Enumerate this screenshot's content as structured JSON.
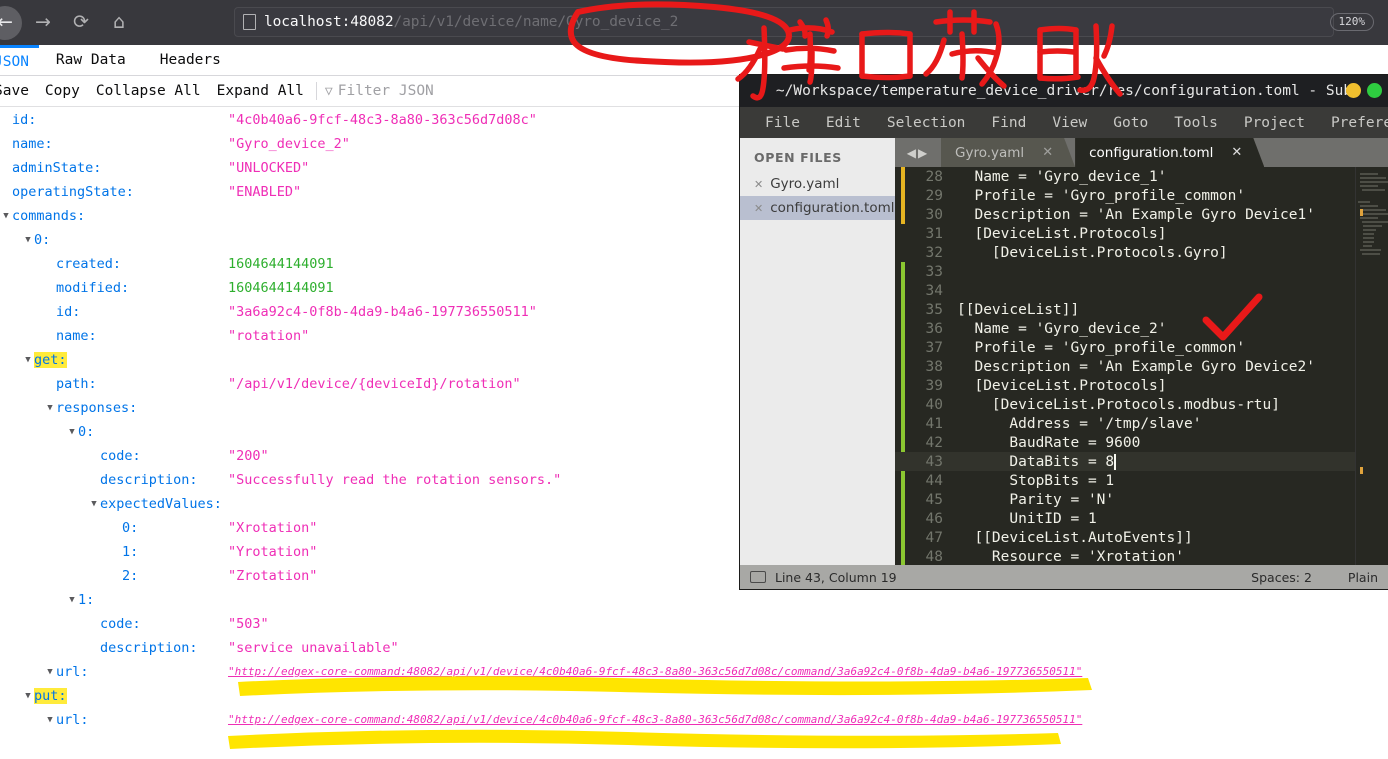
{
  "browser": {
    "nav": {
      "back_icon": "arrow-left-icon",
      "forward_icon": "arrow-right-icon",
      "reload_icon": "reload-icon",
      "home_icon": "home-icon"
    },
    "url_host": "localhost:48082",
    "url_path": "/api/v1/device/name/Gyro_device_2",
    "zoom_level": "120%"
  },
  "json_viewer": {
    "tabs": [
      {
        "label": "JSON",
        "active": true
      },
      {
        "label": "Raw Data",
        "active": false
      },
      {
        "label": "Headers",
        "active": false
      }
    ],
    "toolbar": {
      "save": "Save",
      "copy": "Copy",
      "collapse_all": "Collapse All",
      "expand_all": "Expand All",
      "filter_placeholder": "Filter JSON",
      "filter_icon": "funnel-icon"
    },
    "rows": [
      {
        "indent": 0,
        "twisty": "",
        "key": "id:",
        "value": "\"4c0b40a6-9fcf-48c3-8a80-363c56d7d08c\"",
        "vtype": "str"
      },
      {
        "indent": 0,
        "twisty": "",
        "key": "name:",
        "value": "\"Gyro_device_2\"",
        "vtype": "str"
      },
      {
        "indent": 0,
        "twisty": "",
        "key": "adminState:",
        "value": "\"UNLOCKED\"",
        "vtype": "str"
      },
      {
        "indent": 0,
        "twisty": "",
        "key": "operatingState:",
        "value": "\"ENABLED\"",
        "vtype": "str"
      },
      {
        "indent": 0,
        "twisty": "▼",
        "key": "commands:",
        "value": "",
        "vtype": ""
      },
      {
        "indent": 1,
        "twisty": "▼",
        "key": "0:",
        "value": "",
        "vtype": ""
      },
      {
        "indent": 2,
        "twisty": "",
        "key": "created:",
        "value": "1604644144091",
        "vtype": "num"
      },
      {
        "indent": 2,
        "twisty": "",
        "key": "modified:",
        "value": "1604644144091",
        "vtype": "num"
      },
      {
        "indent": 2,
        "twisty": "",
        "key": "id:",
        "value": "\"3a6a92c4-0f8b-4da9-b4a6-197736550511\"",
        "vtype": "str"
      },
      {
        "indent": 2,
        "twisty": "",
        "key": "name:",
        "value": "\"rotation\"",
        "vtype": "str"
      },
      {
        "indent": 1,
        "twisty": "▼",
        "key": "get:",
        "value": "",
        "vtype": "",
        "highlight": true
      },
      {
        "indent": 2,
        "twisty": "",
        "key": "path:",
        "value": "\"/api/v1/device/{deviceId}/rotation\"",
        "vtype": "str"
      },
      {
        "indent": 2,
        "twisty": "▼",
        "key": "responses:",
        "value": "",
        "vtype": ""
      },
      {
        "indent": 3,
        "twisty": "▼",
        "key": "0:",
        "value": "",
        "vtype": ""
      },
      {
        "indent": 4,
        "twisty": "",
        "key": "code:",
        "value": "\"200\"",
        "vtype": "str"
      },
      {
        "indent": 4,
        "twisty": "",
        "key": "description:",
        "value": "\"Successfully read the rotation sensors.\"",
        "vtype": "str"
      },
      {
        "indent": 4,
        "twisty": "▼",
        "key": "expectedValues:",
        "value": "",
        "vtype": ""
      },
      {
        "indent": 5,
        "twisty": "",
        "key": "0:",
        "value": "\"Xrotation\"",
        "vtype": "str"
      },
      {
        "indent": 5,
        "twisty": "",
        "key": "1:",
        "value": "\"Yrotation\"",
        "vtype": "str"
      },
      {
        "indent": 5,
        "twisty": "",
        "key": "2:",
        "value": "\"Zrotation\"",
        "vtype": "str"
      },
      {
        "indent": 3,
        "twisty": "▼",
        "key": "1:",
        "value": "",
        "vtype": ""
      },
      {
        "indent": 4,
        "twisty": "",
        "key": "code:",
        "value": "\"503\"",
        "vtype": "str"
      },
      {
        "indent": 4,
        "twisty": "",
        "key": "description:",
        "value": "\"service unavailable\"",
        "vtype": "str"
      },
      {
        "indent": 2,
        "twisty": "▼",
        "key": "url:",
        "value": "\"http://edgex-core-command:48082/api/v1/device/4c0b40a6-9fcf-48c3-8a80-363c56d7d08c/command/3a6a92c4-0f8b-4da9-b4a6-197736550511\"",
        "vtype": "url"
      },
      {
        "indent": 1,
        "twisty": "▼",
        "key": "put:",
        "value": "",
        "vtype": "",
        "highlight": true
      },
      {
        "indent": 2,
        "twisty": "▼",
        "key": "url:",
        "value": "\"http://edgex-core-command:48082/api/v1/device/4c0b40a6-9fcf-48c3-8a80-363c56d7d08c/command/3a6a92c4-0f8b-4da9-b4a6-197736550511\"",
        "vtype": "url"
      }
    ]
  },
  "sublime": {
    "title": "~/Workspace/temperature_device_driver/res/configuration.toml - Sub",
    "menu": [
      "File",
      "Edit",
      "Selection",
      "Find",
      "View",
      "Goto",
      "Tools",
      "Project",
      "Preferences"
    ],
    "sidebar": {
      "header": "OPEN FILES",
      "files": [
        {
          "name": "Gyro.yaml",
          "selected": false
        },
        {
          "name": "configuration.toml",
          "selected": true
        }
      ]
    },
    "tabs": [
      {
        "label": "Gyro.yaml",
        "active": false
      },
      {
        "label": "configuration.toml",
        "active": true
      }
    ],
    "code": [
      {
        "n": "28",
        "text": "  Name = 'Gyro_device_1'"
      },
      {
        "n": "29",
        "text": "  Profile = 'Gyro_profile_common'"
      },
      {
        "n": "30",
        "text": "  Description = 'An Example Gyro Device1'"
      },
      {
        "n": "31",
        "text": "  [DeviceList.Protocols]"
      },
      {
        "n": "32",
        "text": "    [DeviceList.Protocols.Gyro]"
      },
      {
        "n": "33",
        "text": ""
      },
      {
        "n": "34",
        "text": ""
      },
      {
        "n": "35",
        "text": "[[DeviceList]]"
      },
      {
        "n": "36",
        "text": "  Name = 'Gyro_device_2'"
      },
      {
        "n": "37",
        "text": "  Profile = 'Gyro_profile_common'"
      },
      {
        "n": "38",
        "text": "  Description = 'An Example Gyro Device2'"
      },
      {
        "n": "39",
        "text": "  [DeviceList.Protocols]"
      },
      {
        "n": "40",
        "text": "    [DeviceList.Protocols.modbus-rtu]"
      },
      {
        "n": "41",
        "text": "      Address = '/tmp/slave'"
      },
      {
        "n": "42",
        "text": "      BaudRate = 9600"
      },
      {
        "n": "43",
        "text": "      DataBits = 8",
        "current": true,
        "cursor": true
      },
      {
        "n": "44",
        "text": "      StopBits = 1"
      },
      {
        "n": "45",
        "text": "      Parity = 'N'"
      },
      {
        "n": "46",
        "text": "      UnitID = 1"
      },
      {
        "n": "47",
        "text": "  [[DeviceList.AutoEvents]]"
      },
      {
        "n": "48",
        "text": "    Resource = 'Xrotation'"
      }
    ],
    "statusbar": {
      "monitor_icon": "monitor-icon",
      "position": "Line 43, Column 19",
      "spaces": "Spaces: 2",
      "syntax": "Plain"
    }
  },
  "annotations": {
    "handwriting_text": "接口获取",
    "pen_color": "#e81919",
    "highlighter_color": "#ffe500",
    "circle_target": "Gyro_device_2",
    "check_target": "Name = 'Gyro_device_2'"
  }
}
